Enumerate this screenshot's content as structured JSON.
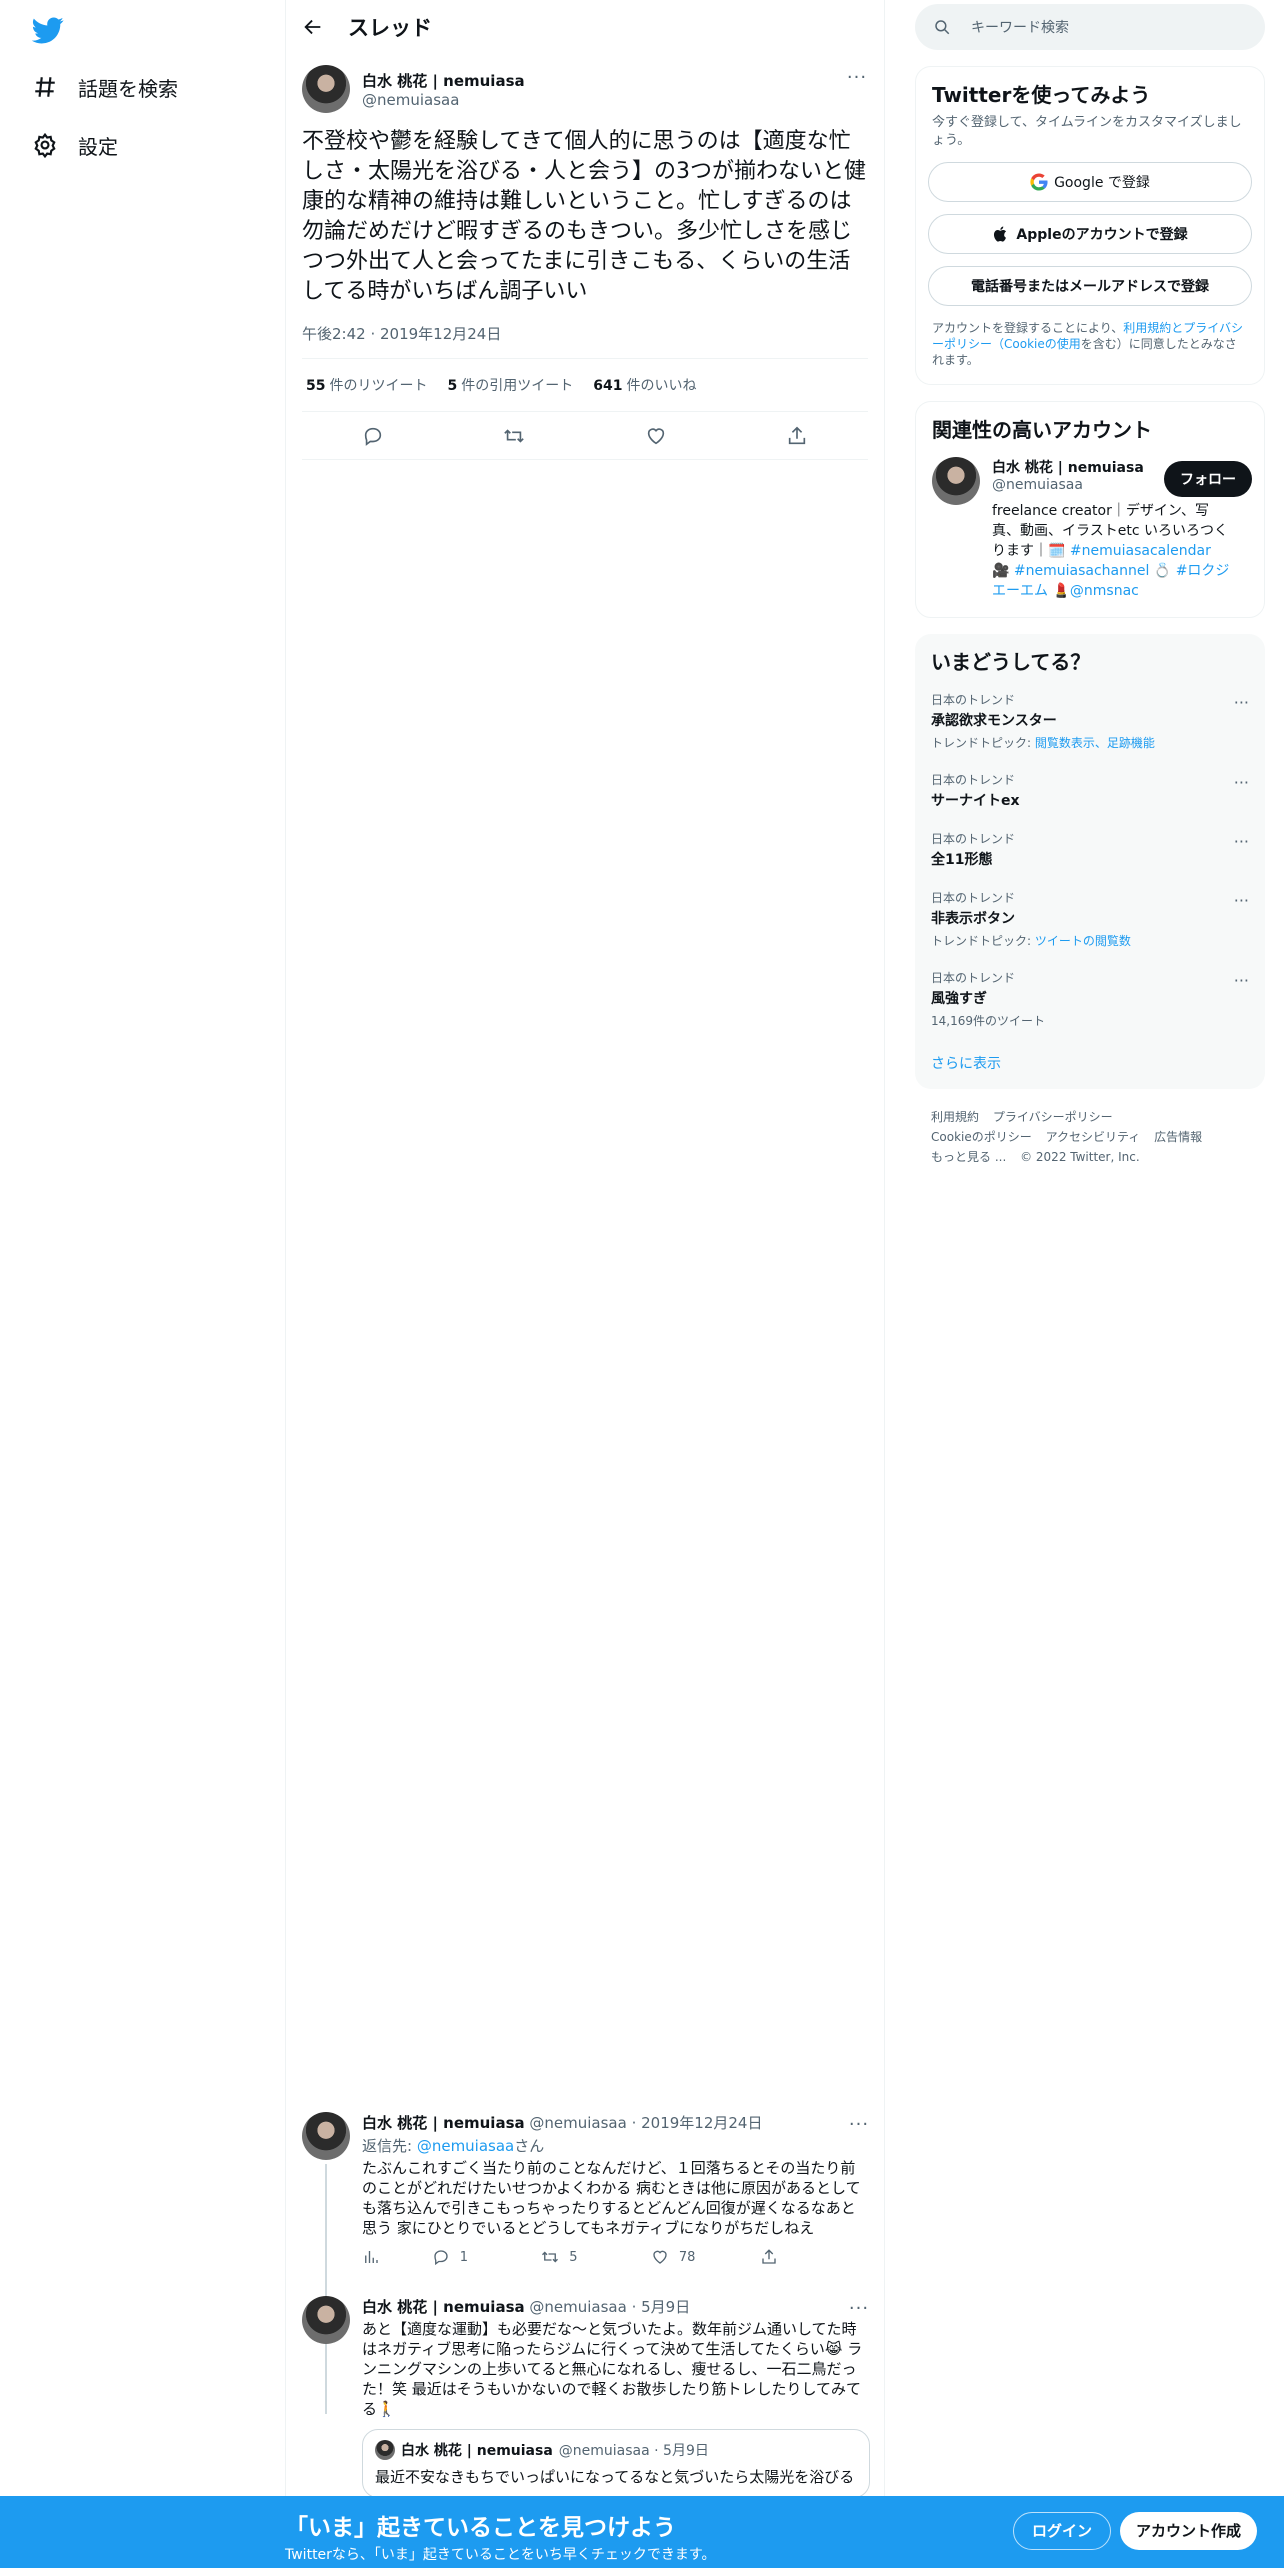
{
  "nav": {
    "items": [
      {
        "label": "話題を検索",
        "icon": "hashtag-icon"
      },
      {
        "label": "設定",
        "icon": "gear-icon"
      }
    ]
  },
  "thread": {
    "header": "スレッド",
    "tweet": {
      "name": "白水 桃花 | nemuiasa",
      "handle": "@nemuiasaa",
      "text": "不登校や鬱を経験してきて個人的に思うのは【適度な忙しさ・太陽光を浴びる・人と会う】の3つが揃わないと健康的な精神の維持は難しいということ。忙しすぎるのは勿論だめだけど暇すぎるのもきつい。多少忙しさを感じつつ外出て人と会ってたまに引きこもる、くらいの生活してる時がいちばん調子いい",
      "time": "午後2:42 · 2019年12月24日",
      "retweets": "55",
      "retweets_label": "件のリツイート",
      "quotes": "5",
      "quotes_label": "件の引用ツイート",
      "likes": "641",
      "likes_label": "件のいいね"
    },
    "replies": [
      {
        "name": "白水 桃花 | nemuiasa",
        "handle_date": "@nemuiasaa · 2019年12月24日",
        "reply_to_prefix": "返信先: ",
        "reply_to": "@nemuiasaa",
        "reply_to_suffix": "さん",
        "text": "たぶんこれすごく当たり前のことなんだけど、１回落ちるとその当たり前のことがどれだけたいせつかよくわかる 病むときは他に原因があるとしても落ち込んで引きこもっちゃったりするとどんどん回復が遅くなるなあと思う 家にひとりでいるとどうしてもネガティブになりがちだしねえ",
        "replies": "1",
        "retweets": "5",
        "likes": "78"
      },
      {
        "name": "白水 桃花 | nemuiasa",
        "handle_date": "@nemuiasaa · 5月9日",
        "text": "あと【適度な運動】も必要だな〜と気づいたよ。数年前ジム通いしてた時はネガティブ思考に陥ったらジムに行くって決めて生活してたくらい😹 ランニングマシンの上歩いてると無心になれるし、痩せるし、一石二鳥だった！笑 最近はそうもいかないので軽くお散歩したり筋トレしたりしてみてる🚶",
        "quote": {
          "name": "白水 桃花 | nemuiasa",
          "handle_date": "@nemuiasaa · 5月9日",
          "text": "最近不安なきもちでいっぱいになってるなと気づいたら太陽光を浴びる"
        }
      }
    ]
  },
  "search": {
    "placeholder": "キーワード検索"
  },
  "signup": {
    "title": "Twitterを使ってみよう",
    "subtitle": "今すぐ登録して、タイムラインをカスタマイズしましょう。",
    "google": "Google で登録",
    "apple": "Appleのアカウントで登録",
    "phone": "電話番号またはメールアドレスで登録",
    "legal_1": "アカウントを登録することにより、",
    "legal_link": "利用規約とプライバシーポリシー（Cookieの使用",
    "legal_2": "を含む）に同意したとみなされます。"
  },
  "relevant": {
    "title": "関連性の高いアカウント",
    "name": "白水 桃花 | nemuiasa",
    "handle": "@nemuiasaa",
    "follow": "フォロー",
    "bio_1": "freelance creator｜デザイン、写真、動画、イラストetc いろいろつくります｜🗓️ ",
    "bio_tag1": "#nemuiasacalendar",
    "bio_2": " 🎥 ",
    "bio_tag2": "#nemuiasachannel",
    "bio_3": " 💍 ",
    "bio_tag3": "#ロクジエーエム",
    "bio_4": " 💄",
    "bio_tag4": "@nmsnac"
  },
  "trends": {
    "title": "いまどうしてる？",
    "items": [
      {
        "category": "日本のトレンド",
        "name": "承認欲求モンスター",
        "sub_prefix": "トレンドトピック: ",
        "sub_link": "閲覧数表示、足跡機能"
      },
      {
        "category": "日本のトレンド",
        "name": "サーナイトex"
      },
      {
        "category": "日本のトレンド",
        "name": "全11形態"
      },
      {
        "category": "日本のトレンド",
        "name": "非表示ボタン",
        "sub_prefix": "トレンドトピック: ",
        "sub_link": "ツイートの閲覧数"
      },
      {
        "category": "日本のトレンド",
        "name": "風強すぎ",
        "sub_plain": "14,169件のツイート"
      }
    ],
    "show_more": "さらに表示"
  },
  "footer": {
    "links": [
      "利用規約",
      "プライバシーポリシー",
      "Cookieのポリシー",
      "アクセシビリティ",
      "広告情報",
      "もっと見る ..."
    ],
    "copyright": "© 2022 Twitter, Inc."
  },
  "bottom": {
    "title": "「いま」起きていることを見つけよう",
    "subtitle": "Twitterなら、「いま」起きていることをいち早くチェックできます。",
    "login": "ログイン",
    "signup": "アカウント作成"
  },
  "colors": {
    "accent": "#1d9bf0",
    "text": "#0f1419",
    "muted": "#536471"
  }
}
